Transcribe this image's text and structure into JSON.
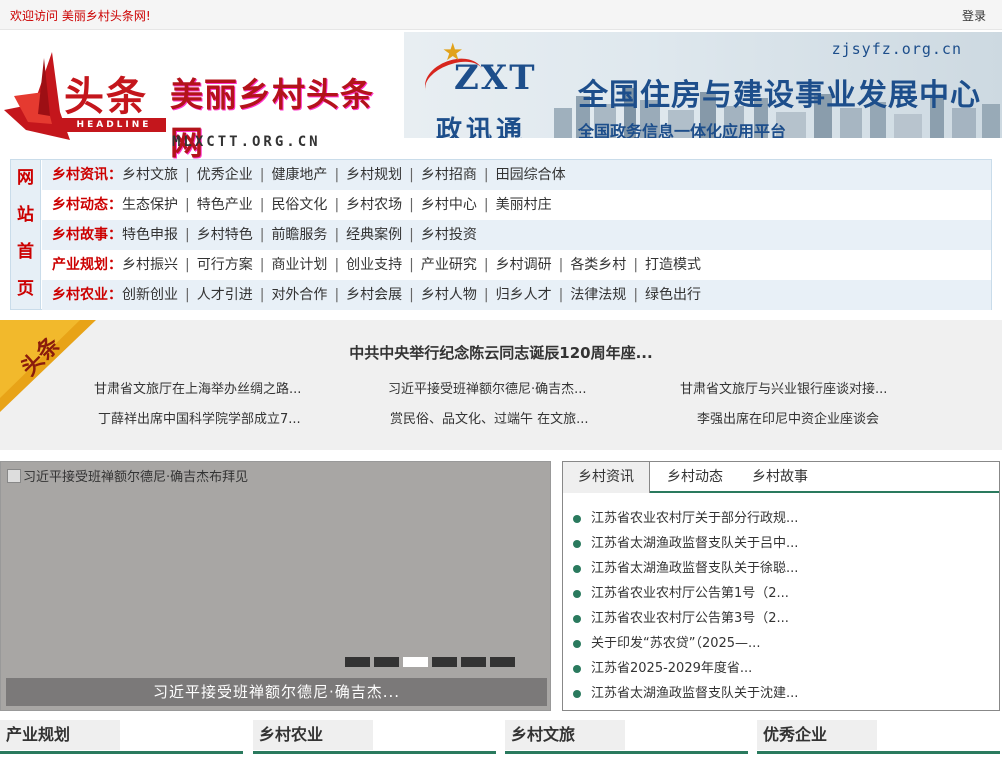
{
  "topbar": {
    "welcome": "欢迎访问 美丽乡村头条网!",
    "login": "登录"
  },
  "logo": {
    "toutiao": "头条",
    "headline_tag": "HEADLINE",
    "site_name": "美丽乡村头条网",
    "site_domain": "MLXCTT.ORG.CN"
  },
  "banner": {
    "zxt": "ZXT",
    "zxt_cn": "政讯通",
    "domain": "zjsyfz.org.cn",
    "title": "全国住房与建设事业发展中心",
    "subtitle": "全国政务信息一体化应用平台"
  },
  "nav": {
    "home_chars": [
      "网",
      "站",
      "首",
      "页"
    ],
    "rows": [
      {
        "title": "乡村资讯：",
        "items": [
          "乡村文旅",
          "优秀企业",
          "健康地产",
          "乡村规划",
          "乡村招商",
          "田园综合体"
        ]
      },
      {
        "title": "乡村动态：",
        "items": [
          "生态保护",
          "特色产业",
          "民俗文化",
          "乡村农场",
          "乡村中心",
          "美丽村庄"
        ]
      },
      {
        "title": "乡村故事：",
        "items": [
          "特色申报",
          "乡村特色",
          "前瞻服务",
          "经典案例",
          "乡村投资"
        ]
      },
      {
        "title": "产业规划：",
        "items": [
          "乡村振兴",
          "可行方案",
          "商业计划",
          "创业支持",
          "产业研究",
          "乡村调研",
          "各类乡村",
          "打造模式"
        ]
      },
      {
        "title": "乡村农业：",
        "items": [
          "创新创业",
          "人才引进",
          "对外合作",
          "乡村会展",
          "乡村人物",
          "归乡人才",
          "法律法规",
          "绿色出行"
        ]
      }
    ]
  },
  "headlines": {
    "ribbon_label": "头条",
    "main": "中共中央举行纪念陈云同志诞辰120周年座...",
    "items": [
      "甘肃省文旅厅在上海举办丝绸之路...",
      "习近平接受班禅额尔德尼·确吉杰...",
      "甘肃省文旅厅与兴业银行座谈对接...",
      "丁薛祥出席中国科学院学部成立7...",
      "赏民俗、品文化、过端午 在文旅...",
      "李强出席在印尼中资企业座谈会"
    ]
  },
  "slideshow": {
    "alt_text": "习近平接受班禅额尔德尼·确吉杰布拜见",
    "caption": "习近平接受班禅额尔德尼·确吉杰...",
    "active_dot": 2,
    "dot_count": 6
  },
  "news": {
    "tabs": [
      "乡村资讯",
      "乡村动态",
      "乡村故事"
    ],
    "active_tab": 0,
    "items": [
      "江苏省农业农村厅关于部分行政规...",
      "江苏省太湖渔政监督支队关于吕中...",
      "江苏省太湖渔政监督支队关于徐聪...",
      "江苏省农业农村厅公告第1号（2...",
      "江苏省农业农村厅公告第3号（2...",
      "关于印发“苏农贷”（2025—...",
      "江苏省2025-2029年度省...",
      "江苏省太湖渔政监督支队关于沈建..."
    ]
  },
  "sections": [
    "产业规划",
    "乡村农业",
    "乡村文旅",
    "优秀企业"
  ],
  "colors": {
    "brand_red": "#c4161c",
    "nav_red": "#cc0000",
    "accent_green": "#2a7a5e",
    "banner_blue": "#1d4e8b"
  }
}
